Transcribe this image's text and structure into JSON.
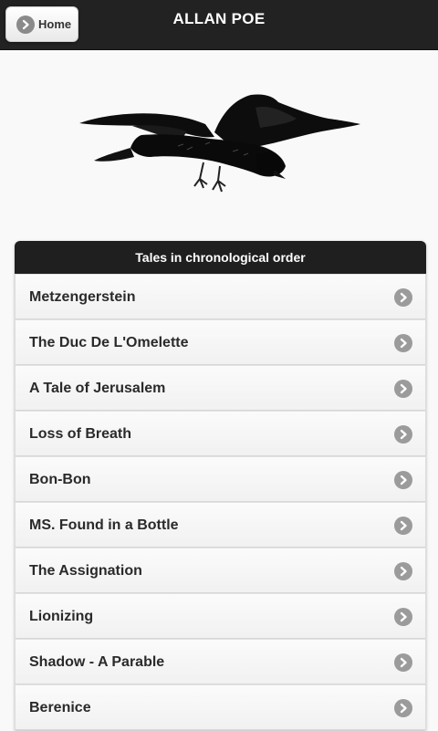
{
  "header": {
    "title": "ALLAN POE",
    "home_label": "Home",
    "home_icon": "arrow-circle-icon"
  },
  "list": {
    "header": "Tales in chronological order",
    "items": [
      {
        "label": "Metzengerstein"
      },
      {
        "label": "The Duc De L'Omelette"
      },
      {
        "label": "A Tale of Jerusalem"
      },
      {
        "label": "Loss of Breath"
      },
      {
        "label": "Bon-Bon"
      },
      {
        "label": "MS. Found in a Bottle"
      },
      {
        "label": "The Assignation"
      },
      {
        "label": "Lionizing"
      },
      {
        "label": "Shadow - A Parable"
      },
      {
        "label": "Berenice"
      }
    ]
  },
  "colors": {
    "header_bg": "#222222",
    "page_bg": "#f9f9f9",
    "arrow_bg": "#9b9b9b"
  }
}
